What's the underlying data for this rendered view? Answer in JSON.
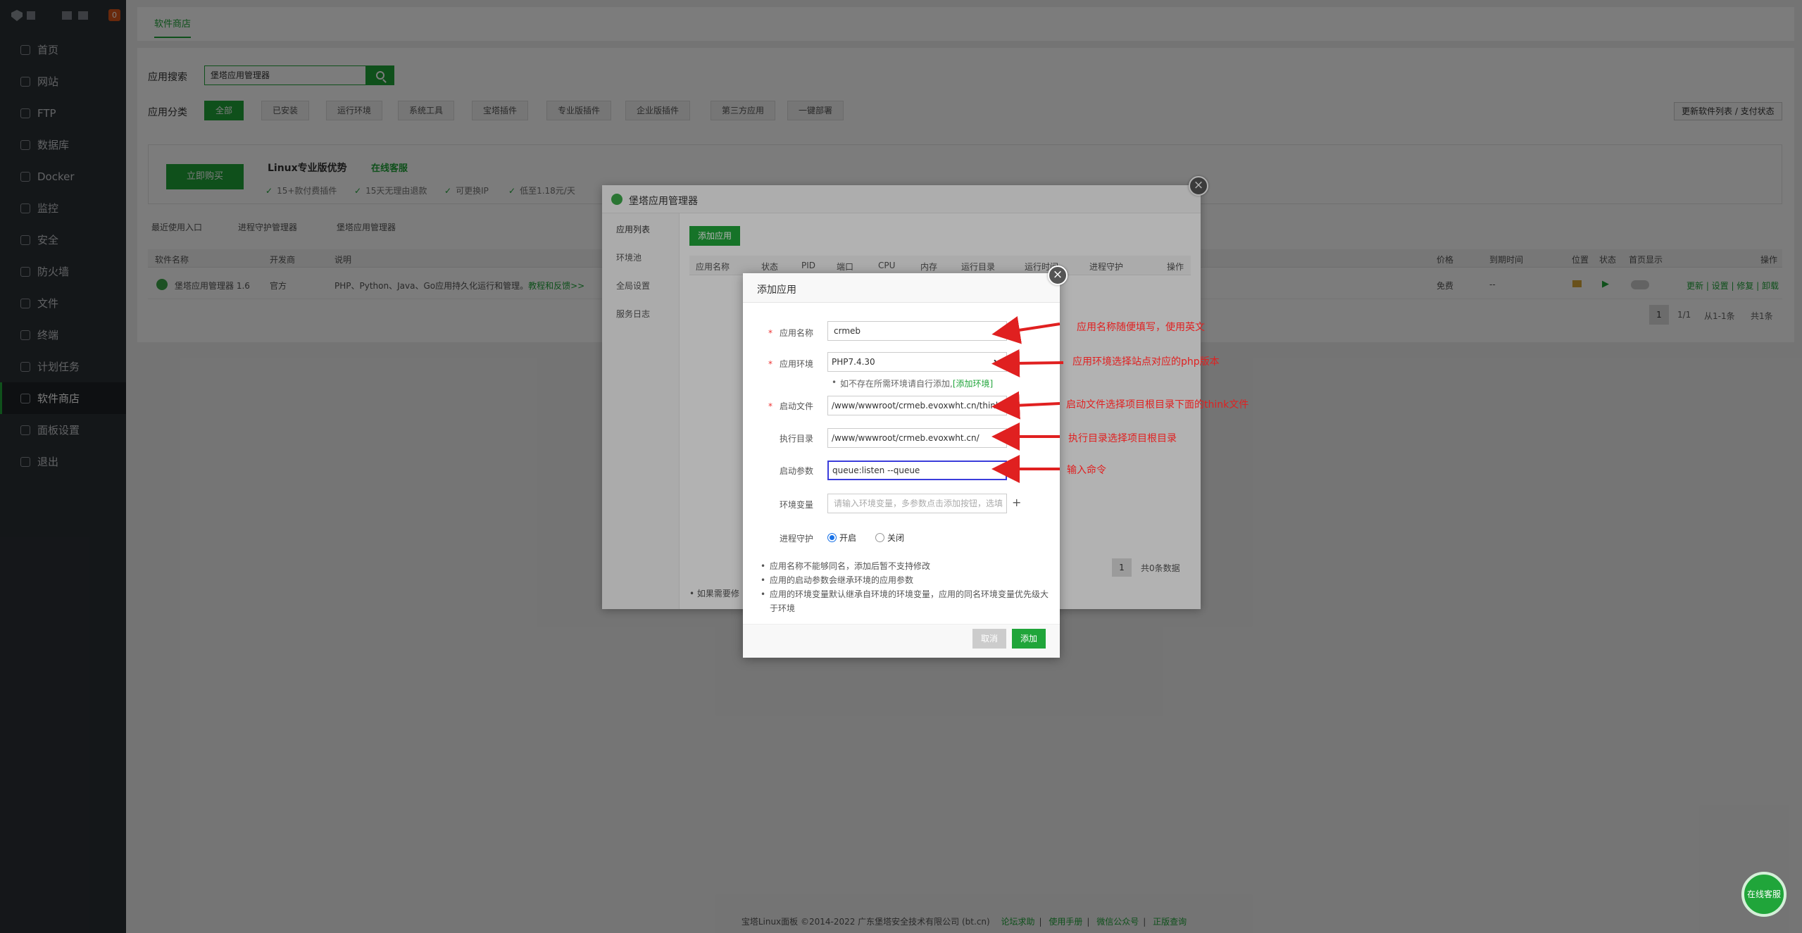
{
  "sidebar": {
    "badge": "0",
    "items": [
      {
        "label": "首页",
        "icon": "home-icon"
      },
      {
        "label": "网站",
        "icon": "globe-icon"
      },
      {
        "label": "FTP",
        "icon": "ftp-icon"
      },
      {
        "label": "数据库",
        "icon": "database-icon"
      },
      {
        "label": "Docker",
        "icon": "docker-icon"
      },
      {
        "label": "监控",
        "icon": "monitor-icon"
      },
      {
        "label": "安全",
        "icon": "shield-icon"
      },
      {
        "label": "防火墙",
        "icon": "firewall-icon"
      },
      {
        "label": "文件",
        "icon": "folder-icon"
      },
      {
        "label": "终端",
        "icon": "terminal-icon"
      },
      {
        "label": "计划任务",
        "icon": "clock-icon"
      },
      {
        "label": "软件商店",
        "icon": "grid-icon"
      },
      {
        "label": "面板设置",
        "icon": "settings-icon"
      },
      {
        "label": "退出",
        "icon": "logout-icon"
      }
    ],
    "active_index": 11
  },
  "topbar": {
    "tab": "软件商店"
  },
  "search": {
    "label": "应用搜索",
    "value": "堡塔应用管理器"
  },
  "categories": {
    "label": "应用分类",
    "items": [
      "全部",
      "已安装",
      "运行环境",
      "系统工具",
      "宝塔插件",
      "专业版插件",
      "企业版插件",
      "第三方应用",
      "一键部署"
    ],
    "active_index": 0,
    "update_button": "更新软件列表 / 支付状态"
  },
  "promo": {
    "buy": "立即购买",
    "title": "Linux专业版优势",
    "kefu": "在线客服",
    "features": [
      "15+款付费插件",
      "15天无理由退款",
      "可更换IP",
      "低至1.18元/天"
    ]
  },
  "recent": {
    "label": "最近使用入口",
    "items": [
      "进程守护管理器",
      "堡塔应用管理器"
    ]
  },
  "table": {
    "headers": {
      "name": "软件名称",
      "dev": "开发商",
      "desc": "说明",
      "price": "价格",
      "expire": "到期时间",
      "pos": "位置",
      "status": "状态",
      "home": "首页显示",
      "ops": "操作"
    },
    "row": {
      "name": "堡塔应用管理器 1.6",
      "dev": "官方",
      "desc": "PHP、Python、Java、Go应用持久化运行和管理。",
      "desc_link": "教程和反馈>>",
      "price": "免费",
      "expire": "--",
      "ops": "更新 | 设置 | 修复 | 卸载"
    },
    "pagination": {
      "page": "1",
      "total_pages": "1/1",
      "range": "从1-1条",
      "count": "共1条"
    }
  },
  "dialog1": {
    "title": "堡塔应用管理器",
    "side": [
      "应用列表",
      "环境池",
      "全局设置",
      "服务日志"
    ],
    "add_button": "添加应用",
    "headers": [
      "应用名称",
      "状态",
      "PID",
      "端口",
      "CPU",
      "内存",
      "运行目录",
      "运行时间",
      "进程守护",
      "操作"
    ],
    "page": "1",
    "page_total": "共0条数据",
    "note": "如果需要修"
  },
  "dialog2": {
    "title": "添加应用",
    "name": {
      "label": "应用名称",
      "value": "crmeb"
    },
    "env": {
      "label": "应用环境",
      "value": "PHP7.4.30"
    },
    "env_help": "如不存在所需环境请自行添加,",
    "env_help_link": "[添加环境]",
    "start_file": {
      "label": "启动文件",
      "value": "/www/wwwroot/crmeb.evoxwht.cn/think"
    },
    "exec_dir": {
      "label": "执行目录",
      "value": "/www/wwwroot/crmeb.evoxwht.cn/"
    },
    "args": {
      "label": "启动参数",
      "value": "queue:listen --queue"
    },
    "env_vars": {
      "label": "环境变量",
      "placeholder": "请输入环境变量，多参数点击添加按钮，选填"
    },
    "guard": {
      "label": "进程守护",
      "on": "开启",
      "off": "关闭",
      "selected": "开启"
    },
    "tips": [
      "应用名称不能够同名，添加后暂不支持修改",
      "应用的启动参数会继承环境的应用参数",
      "应用的环境变量默认继承自环境的环境变量，应用的同名环境变量优先级大于环境"
    ],
    "cancel": "取消",
    "submit": "添加"
  },
  "annotations": [
    "应用名称随便填写，使用英文",
    "应用环境选择站点对应的php版本",
    "启动文件选择项目根目录下面的think文件",
    "执行目录选择项目根目录",
    "输入命令"
  ],
  "footer": {
    "copyright": "宝塔Linux面板 ©2014-2022 广东堡塔安全技术有限公司 (bt.cn)",
    "links": [
      "论坛求助",
      "使用手册",
      "微信公众号",
      "正版查询"
    ]
  },
  "chat_button": "在线客服",
  "colors": {
    "accent": "#20a53a",
    "sidebar": "#2b3035",
    "annotation": "#e02020"
  }
}
